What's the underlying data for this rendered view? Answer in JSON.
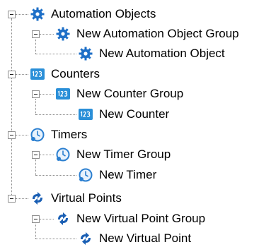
{
  "tree": {
    "automation": {
      "label": "Automation Objects",
      "icon": "gear-icon",
      "group": {
        "label": "New Automation Object Group",
        "item": {
          "label": "New Automation Object"
        }
      }
    },
    "counters": {
      "label": "Counters",
      "icon": "counter-123-icon",
      "group": {
        "label": "New Counter Group",
        "item": {
          "label": "New Counter"
        }
      }
    },
    "timers": {
      "label": "Timers",
      "icon": "clock-icon",
      "group": {
        "label": "New Timer Group",
        "item": {
          "label": "New Timer"
        }
      }
    },
    "virtual_points": {
      "label": "Virtual Points",
      "icon": "virtual-point-arrows-icon",
      "group": {
        "label": "New Virtual Point Group",
        "item": {
          "label": "New Virtual Point"
        }
      }
    }
  },
  "colors": {
    "gear": "#1e6fc7",
    "counter": "#2a8fd8",
    "timer": "#2b7fd0",
    "virtual": "#1a5fb4"
  }
}
